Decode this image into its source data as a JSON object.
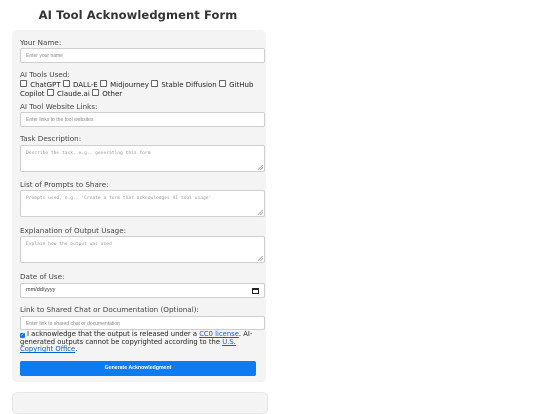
{
  "page": {
    "title": "AI Tool Acknowledgment Form"
  },
  "form": {
    "name": {
      "label": "Your Name:",
      "placeholder": "Enter your name"
    },
    "tools": {
      "label": "AI Tools Used:",
      "options": [
        "ChatGPT",
        "DALL-E",
        "Midjourney",
        "Stable Diffusion",
        "GitHub Copilot",
        "Claude.ai",
        "Other"
      ]
    },
    "links": {
      "label": "AI Tool Website Links:",
      "placeholder": "Enter links to the tool websites"
    },
    "task": {
      "label": "Task Description:",
      "placeholder": "Describe the task, e.g., generating this form"
    },
    "prompts": {
      "label": "List of Prompts to Share:",
      "placeholder": "Prompts used, e.g., 'Create a form that acknowledges AI tool usage'"
    },
    "usage": {
      "label": "Explanation of Output Usage:",
      "placeholder": "Explain how the output was used"
    },
    "date": {
      "label": "Date of Use:",
      "placeholder": "mm/dd/yyyy"
    },
    "share_link": {
      "label": "Link to Shared Chat or Documentation (Optional):",
      "placeholder": "Enter link to shared chat or documentation"
    },
    "acknowledge": {
      "checked": true,
      "text_before": "I acknowledge that the output is released under a",
      "cc0_link": "CC0 license",
      "text_middle": ". AI-generated outputs cannot be copyrighted according to the",
      "copyright_link": "U.S. Copyright Office",
      "text_after": "."
    },
    "submit_label": "Generate Acknowledgment"
  },
  "colors": {
    "accent": "#0d7bf2",
    "link": "#0b5fcc",
    "card": "#f4f4f4"
  }
}
